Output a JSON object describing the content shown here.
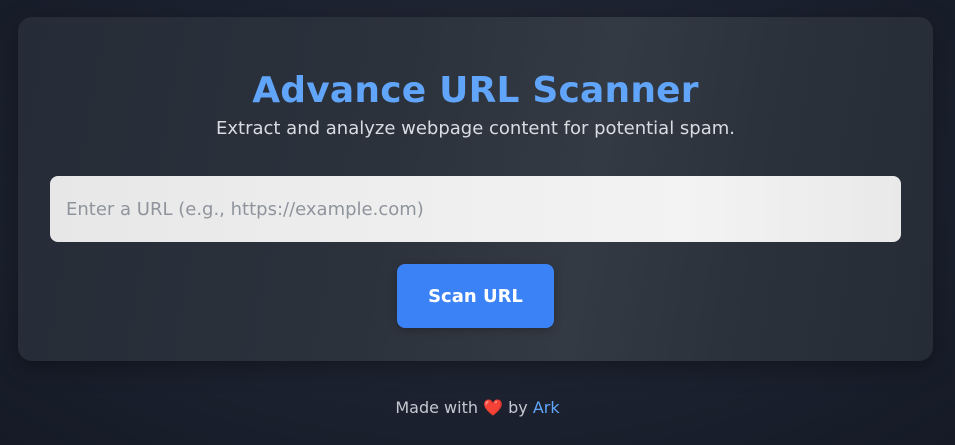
{
  "header": {
    "title": "Advance URL Scanner",
    "subtitle": "Extract and analyze webpage content for potential spam."
  },
  "form": {
    "url_value": "",
    "url_placeholder": "Enter a URL (e.g., https://example.com)",
    "scan_label": "Scan URL"
  },
  "footer": {
    "made_with": "Made with",
    "heart": "❤️",
    "by": "by",
    "author": "Ark"
  },
  "colors": {
    "accent": "#60a5fa",
    "button": "#3b82f6",
    "heart": "#ef4444"
  }
}
